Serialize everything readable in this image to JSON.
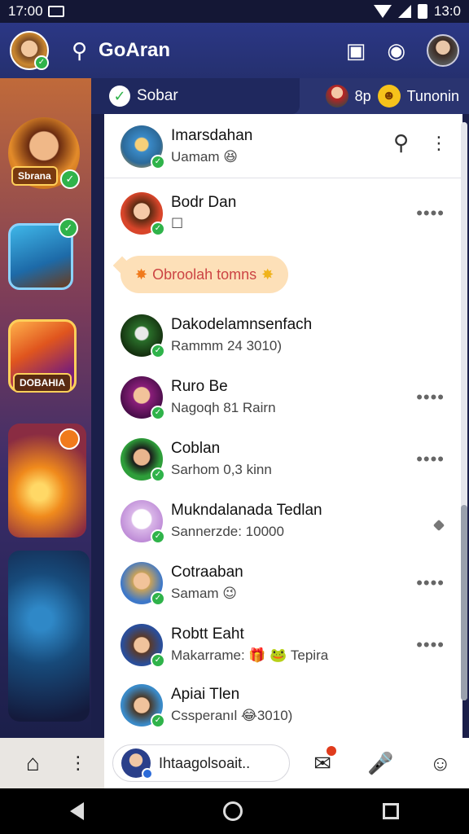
{
  "status_bar": {
    "time_left": "17:00",
    "time_right": "13:0"
  },
  "app_bar": {
    "title": "GoAran"
  },
  "sub_bar": {
    "chip_label": "Sobar",
    "count": "8p",
    "right_label": "Tunonin"
  },
  "rail": {
    "tile_label_top": "Sbrana",
    "tile_label_bottom": "DOBAHIA"
  },
  "pinned": {
    "name": "Imarsdahan",
    "sub": "Uamam 😆"
  },
  "bubble": {
    "text": "Obroolah tomns",
    "left_emoji": "✸",
    "right_emoji": "✸"
  },
  "chats": [
    {
      "name": "Bodr Dan",
      "sub": "☐",
      "avatar_color": "#d8452a",
      "more": "••••"
    },
    {
      "name": "Dakodelamnsenfach",
      "sub": "Rammm 24 3010)",
      "avatar_color": "#2a6e2a",
      "more": ""
    },
    {
      "name": "Ruro Be",
      "sub": "Nagoqh 81 Rairn",
      "avatar_color": "#8a1e7a",
      "more": "••••"
    },
    {
      "name": "Coblan",
      "sub": "Sarhom 0,3 kinn",
      "avatar_color": "#2e9e3a",
      "more": "••••"
    },
    {
      "name": "Mukndalanada Tedlan",
      "sub": "Sannerzde: 10000",
      "avatar_color": "#d9b6e8",
      "more": ""
    },
    {
      "name": "Cotraaban",
      "sub": "Samam 😉",
      "avatar_color": "#3e78c8",
      "more": "••••"
    },
    {
      "name": "Robtt Eaht",
      "sub": "Makarrame: 🎁 🐸 Tepira",
      "avatar_color": "#2a4e9a",
      "more": "••••"
    },
    {
      "name": "Apiai Tlen",
      "sub": "Cssperanıl 😂3010)",
      "avatar_color": "#3a8ac8",
      "more": ""
    }
  ],
  "composer": {
    "input_text": "Ihtaagolsoait..",
    "badge_count": ""
  },
  "icons": {
    "search": "search-icon",
    "settings": "gear-icon",
    "home": "home-icon"
  },
  "colors": {
    "accent": "#2fb34a",
    "header": "#2b3785",
    "bubble": "#fde0b8"
  }
}
